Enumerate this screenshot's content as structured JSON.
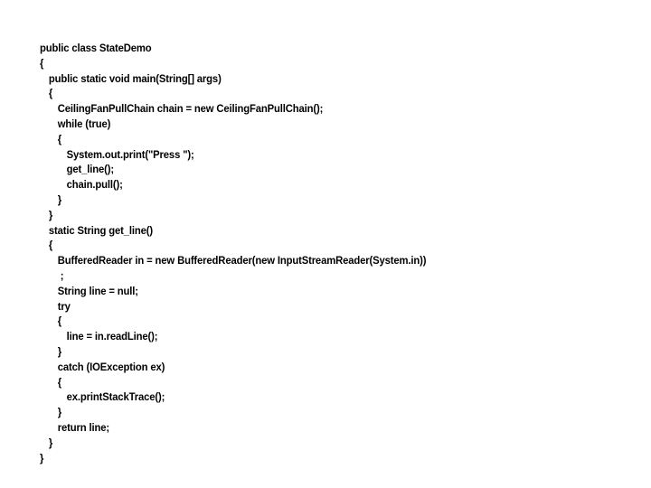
{
  "slide": {
    "background_color": "#ffffff",
    "text_color": "#000000",
    "language": "java",
    "class_name": "StateDemo"
  },
  "code": {
    "lines": [
      {
        "indent": 0,
        "text": "public class StateDemo"
      },
      {
        "indent": 0,
        "text": "{"
      },
      {
        "indent": 1,
        "text": "public static void main(String[] args)"
      },
      {
        "indent": 1,
        "text": "{"
      },
      {
        "indent": 2,
        "text": "CeilingFanPullChain chain = new CeilingFanPullChain();"
      },
      {
        "indent": 2,
        "text": "while (true)"
      },
      {
        "indent": 2,
        "text": "{"
      },
      {
        "indent": 3,
        "text": "System.out.print(\"Press \");"
      },
      {
        "indent": 3,
        "text": "get_line();"
      },
      {
        "indent": 3,
        "text": "chain.pull();"
      },
      {
        "indent": 2,
        "text": "}"
      },
      {
        "indent": 1,
        "text": "}"
      },
      {
        "indent": 1,
        "text": "static String get_line()"
      },
      {
        "indent": 1,
        "text": "{"
      },
      {
        "indent": 2,
        "text": "BufferedReader in = new BufferedReader(new InputStreamReader(System.in))"
      },
      {
        "indent": 2,
        "text": " ;"
      },
      {
        "indent": 2,
        "text": "String line = null;"
      },
      {
        "indent": 2,
        "text": "try"
      },
      {
        "indent": 2,
        "text": "{"
      },
      {
        "indent": 3,
        "text": "line = in.readLine();"
      },
      {
        "indent": 2,
        "text": "}"
      },
      {
        "indent": 2,
        "text": "catch (IOException ex)"
      },
      {
        "indent": 2,
        "text": "{"
      },
      {
        "indent": 3,
        "text": "ex.printStackTrace();"
      },
      {
        "indent": 2,
        "text": "}"
      },
      {
        "indent": 2,
        "text": "return line;"
      },
      {
        "indent": 1,
        "text": "}"
      },
      {
        "indent": 0,
        "text": "}"
      }
    ]
  }
}
